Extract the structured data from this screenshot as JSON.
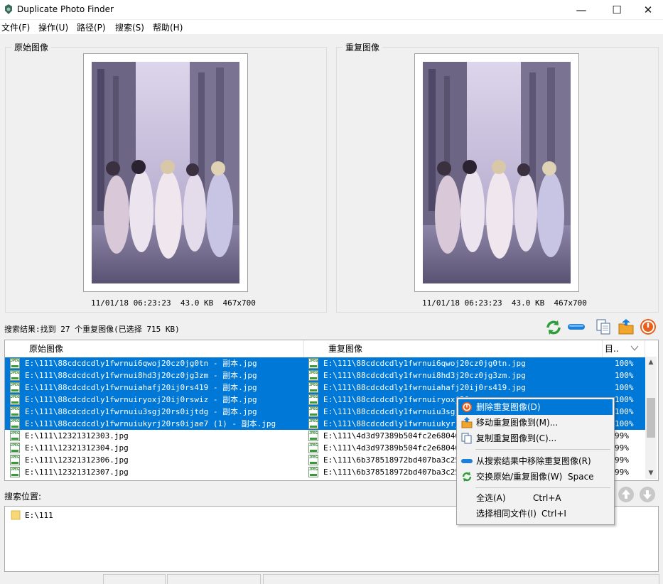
{
  "window": {
    "title": "Duplicate Photo Finder",
    "min": "—",
    "max": "☐",
    "close": "✕"
  },
  "menu": [
    "文件(F)",
    "操作(U)",
    "路径(P)",
    "搜索(S)",
    "帮助(H)"
  ],
  "original_panel": {
    "label": "原始图像",
    "date": "11/01/18 06:23:23",
    "size": "43.0 KB",
    "dims": "467x700"
  },
  "duplicate_panel": {
    "label": "重复图像",
    "date": "11/01/18 06:23:23",
    "size": "43.0 KB",
    "dims": "467x700"
  },
  "results": {
    "summary": "搜索结果:找到 27 个重复图像(已选择 715 KB)",
    "columns": {
      "original": "原始图像",
      "duplicate": "重复图像",
      "similarity": "目.."
    },
    "rows": [
      {
        "orig": "E:\\111\\88cdcdcdly1fwrnui6qwoj20cz0jg0tn - 副本.jpg",
        "dup": "E:\\111\\88cdcdcdly1fwrnui6qwoj20cz0jg0tn.jpg",
        "sim": "100%",
        "selected": true
      },
      {
        "orig": "E:\\111\\88cdcdcdly1fwrnui8hd3j20cz0jg3zm - 副本.jpg",
        "dup": "E:\\111\\88cdcdcdly1fwrnui8hd3j20cz0jg3zm.jpg",
        "sim": "100%",
        "selected": true
      },
      {
        "orig": "E:\\111\\88cdcdcdly1fwrnuiahafj20ij0rs419 - 副本.jpg",
        "dup": "E:\\111\\88cdcdcdly1fwrnuiahafj20ij0rs419.jpg",
        "sim": "100%",
        "selected": true
      },
      {
        "orig": "E:\\111\\88cdcdcdly1fwrnuiryoxj20ij0rswiz - 副本.jpg",
        "dup": "E:\\111\\88cdcdcdly1fwrnuiryoxj20",
        "sim": "100%",
        "selected": true
      },
      {
        "orig": "E:\\111\\88cdcdcdly1fwrnuiu3sgj20rs0ijtdg - 副本.jpg",
        "dup": "E:\\111\\88cdcdcdly1fwrnuiu3sgj20",
        "sim": "100%",
        "selected": true
      },
      {
        "orig": "E:\\111\\88cdcdcdly1fwrnuiukyrj20rs0ijae7 (1) - 副本.jpg",
        "dup": "E:\\111\\88cdcdcdly1fwrnuiukyrj20",
        "sim": "100%",
        "selected": true
      },
      {
        "orig": "E:\\111\\12321312303.jpg",
        "dup": "E:\\111\\4d3d97389b504fc2e68046b6",
        "sim": "99%",
        "selected": false
      },
      {
        "orig": "E:\\111\\12321312304.jpg",
        "dup": "E:\\111\\4d3d97389b504fc2e68046b6",
        "sim": "99%",
        "selected": false
      },
      {
        "orig": "E:\\111\\12321312306.jpg",
        "dup": "E:\\111\\6b378518972bd407ba3c254e",
        "sim": "99%",
        "selected": false
      },
      {
        "orig": "E:\\111\\12321312307.jpg",
        "dup": "E:\\111\\6b378518972bd407ba3c254e",
        "sim": "99%",
        "selected": false
      }
    ]
  },
  "icon_text": {
    "jpeg": "JPEG"
  },
  "context_menu": {
    "items": [
      {
        "label": "删除重复图像(D)",
        "shortcut": ""
      },
      {
        "label": "移动重复图像到(M)...",
        "shortcut": ""
      },
      {
        "label": "复制重复图像到(C)...",
        "shortcut": ""
      },
      {
        "label": "从搜索结果中移除重复图像(R)",
        "shortcut": ""
      },
      {
        "label": "交换原始/重复图像(W)",
        "shortcut": "Space"
      },
      {
        "label": "全选(A)",
        "shortcut": "Ctrl+A"
      },
      {
        "label": "选择相同文件(I)",
        "shortcut": "Ctrl+I"
      }
    ]
  },
  "search_location": {
    "label": "搜索位置:",
    "paths": [
      "E:\\111"
    ]
  },
  "colors": {
    "selection": "#0078d7",
    "refresh_green": "#2e9e3a",
    "remove_blue": "#1e7fd8",
    "delete_orange": "#e8601c"
  }
}
